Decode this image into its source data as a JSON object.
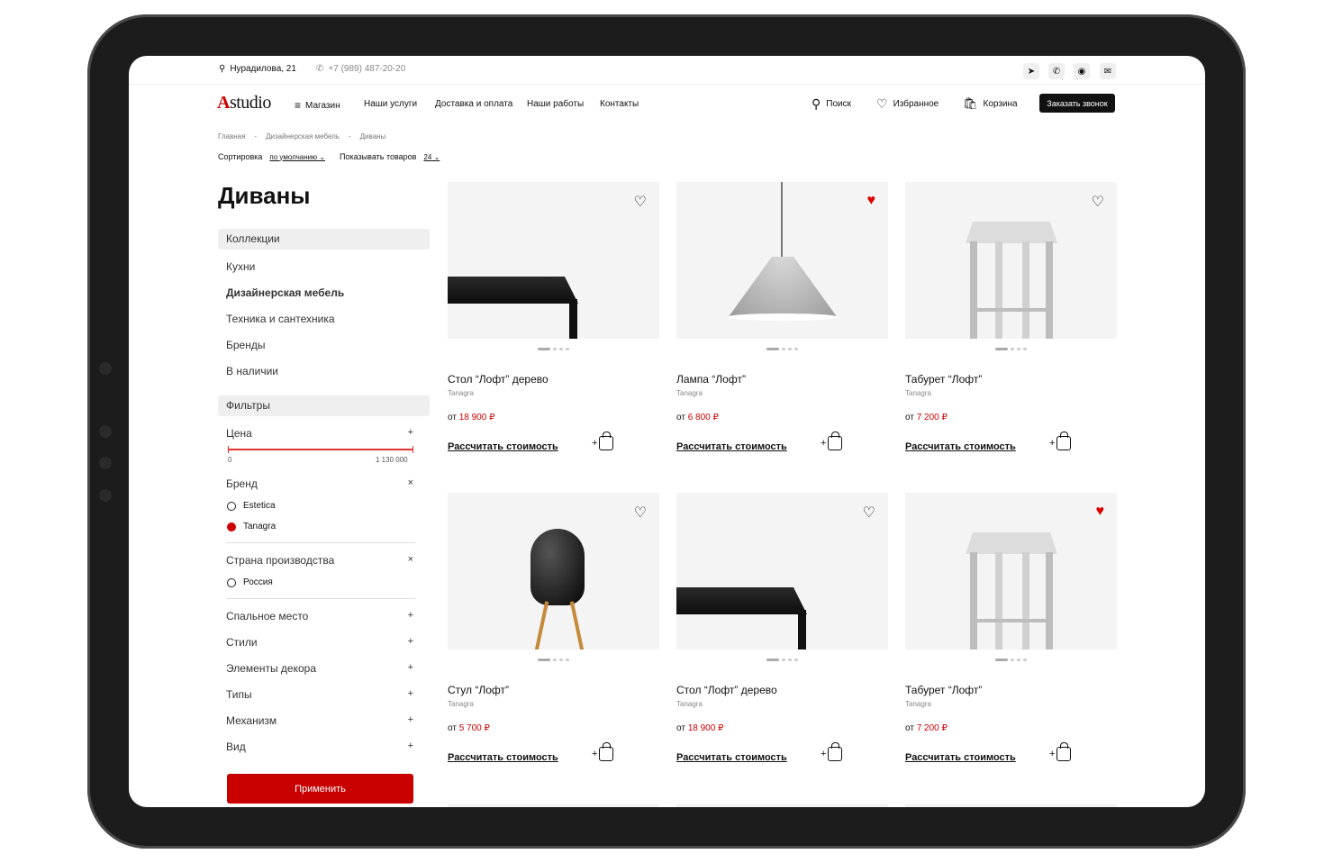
{
  "topbar": {
    "address": "Нурадилова, 21",
    "phone": "+7 (989) 487-20-20",
    "social_icons": [
      "telegram-icon",
      "whatsapp-icon",
      "instagram-icon",
      "mail-icon"
    ]
  },
  "header": {
    "logo_a": "A",
    "logo_rest": "studio",
    "menu": [
      "Магазин",
      "Наши услуги",
      "Доставка и оплата",
      "Наши работы",
      "Контакты"
    ],
    "search": "Поиск",
    "favorites": "Избранное",
    "cart": "Корзина",
    "callback": "Заказать звонок"
  },
  "breadcrumbs": [
    "Главная",
    "-",
    "Дизайнерская мебель",
    "-",
    "Диваны"
  ],
  "sort": {
    "sort_label": "Сортировка",
    "sort_value": "по умолчанию",
    "show_label": "Показывать товаров",
    "show_value": "24"
  },
  "page_title": "Диваны",
  "sidebar": {
    "collections_title": "Коллекции",
    "collections": [
      "Кухни",
      "Дизайнерская мебель",
      "Техника и сантехника",
      "Бренды",
      "В наличии"
    ],
    "filters_title": "Фильтры",
    "price_label": "Цена",
    "price_min": "0",
    "price_max": "1 130 000",
    "brand_label": "Бренд",
    "brands": [
      {
        "name": "Estetica",
        "checked": false
      },
      {
        "name": "Tanagra",
        "checked": true
      }
    ],
    "country_label": "Страна производства",
    "countries": [
      {
        "name": "Россия",
        "checked": false
      }
    ],
    "more_filters": [
      "Спальное место",
      "Стили",
      "Элементы декора",
      "Типы",
      "Механизм",
      "Вид"
    ],
    "plus": "+",
    "cross": "×",
    "apply": "Применить"
  },
  "card_common": {
    "from": "от",
    "calc": "Рассчитать стоимость",
    "add": "+"
  },
  "products": [
    {
      "name": "Стол “Лофт” дерево",
      "brand": "Tanagra",
      "price": "18 900 ₽",
      "favorite": false,
      "kind": "table"
    },
    {
      "name": "Лампа “Лофт”",
      "brand": "Tanagra",
      "price": "6 800 ₽",
      "favorite": true,
      "kind": "lamp"
    },
    {
      "name": "Табурет “Лофт”",
      "brand": "Tanagra",
      "price": "7 200 ₽",
      "favorite": false,
      "kind": "stool"
    },
    {
      "name": "Стул “Лофт”",
      "brand": "Tanagra",
      "price": "5 700 ₽",
      "favorite": false,
      "kind": "chair"
    },
    {
      "name": "Стол “Лофт” дерево",
      "brand": "Tanagra",
      "price": "18 900 ₽",
      "favorite": false,
      "kind": "table"
    },
    {
      "name": "Табурет “Лофт”",
      "brand": "Tanagra",
      "price": "7 200 ₽",
      "favorite": true,
      "kind": "stool"
    }
  ],
  "colors": {
    "accent": "#c80000",
    "dark": "#111111"
  }
}
